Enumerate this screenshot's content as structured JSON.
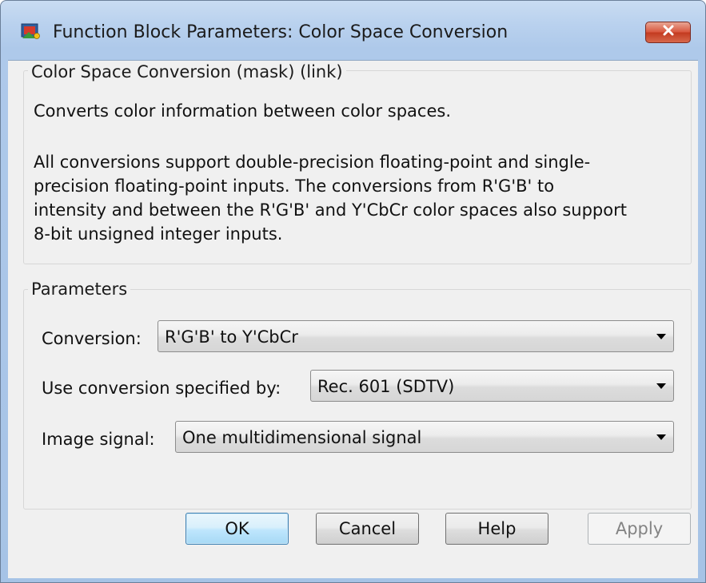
{
  "window": {
    "title": "Function Block Parameters: Color Space Conversion",
    "app_icon": "simulink-block-icon",
    "close_icon": "close-icon",
    "accent_colors": {
      "close": "#c9432a",
      "default_button": "#3c7fb1",
      "titlebar": "#b9d1ee"
    }
  },
  "description_group": {
    "legend": "Color Space Conversion (mask) (link)",
    "summary": "Converts color information between color spaces.",
    "details_lines": [
      "All conversions support double-precision floating-point and single-",
      "precision floating-point inputs. The conversions from R'G'B' to",
      "intensity and between the R'G'B' and Y'CbCr color spaces also support",
      "8-bit unsigned integer inputs."
    ]
  },
  "parameters_group": {
    "legend": "Parameters",
    "fields": [
      {
        "label": "Conversion:",
        "value": "R'G'B' to Y'CbCr"
      },
      {
        "label": "Use conversion specified by:",
        "value": "Rec. 601 (SDTV)"
      },
      {
        "label": "Image signal:",
        "value": "One multidimensional signal"
      }
    ]
  },
  "buttons": {
    "ok": "OK",
    "cancel": "Cancel",
    "help": "Help",
    "apply": "Apply"
  }
}
